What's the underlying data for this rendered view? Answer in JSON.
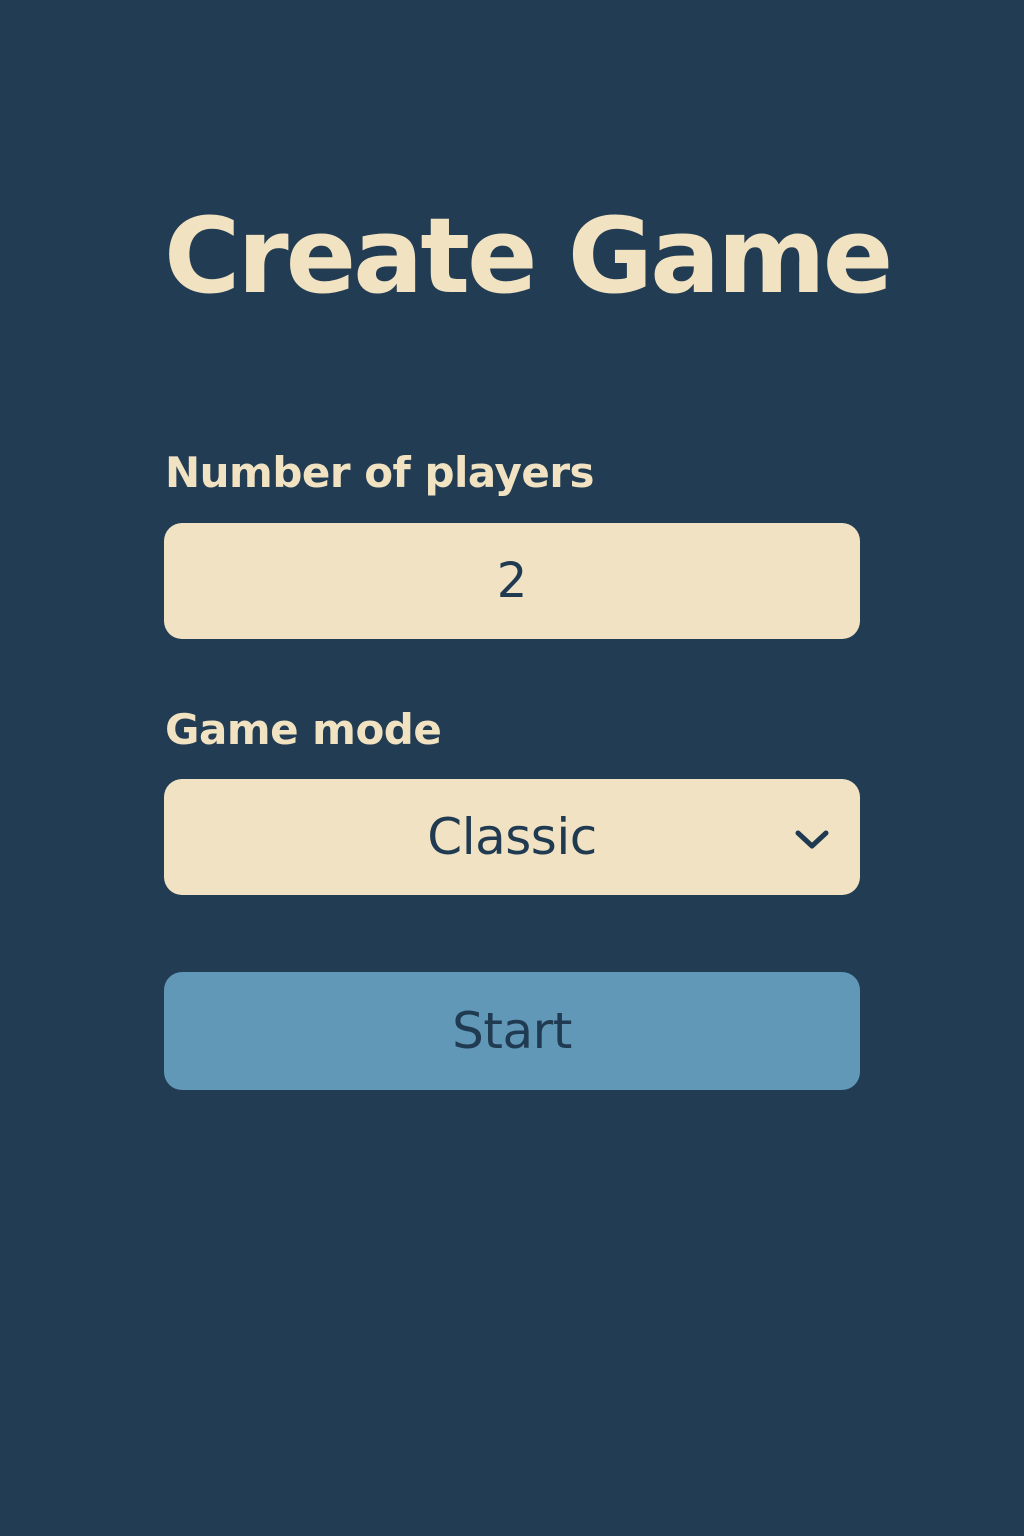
{
  "page": {
    "title": "Create Game"
  },
  "form": {
    "players": {
      "label": "Number of players",
      "value": "2"
    },
    "mode": {
      "label": "Game mode",
      "selected": "Classic",
      "icon": "chevron-down-icon"
    },
    "start_label": "Start"
  },
  "colors": {
    "background": "#223c53",
    "field": "#f0e2c2",
    "text_light": "#f1e2c1",
    "text_dark": "#1f3a51",
    "button": "#6197b7"
  }
}
